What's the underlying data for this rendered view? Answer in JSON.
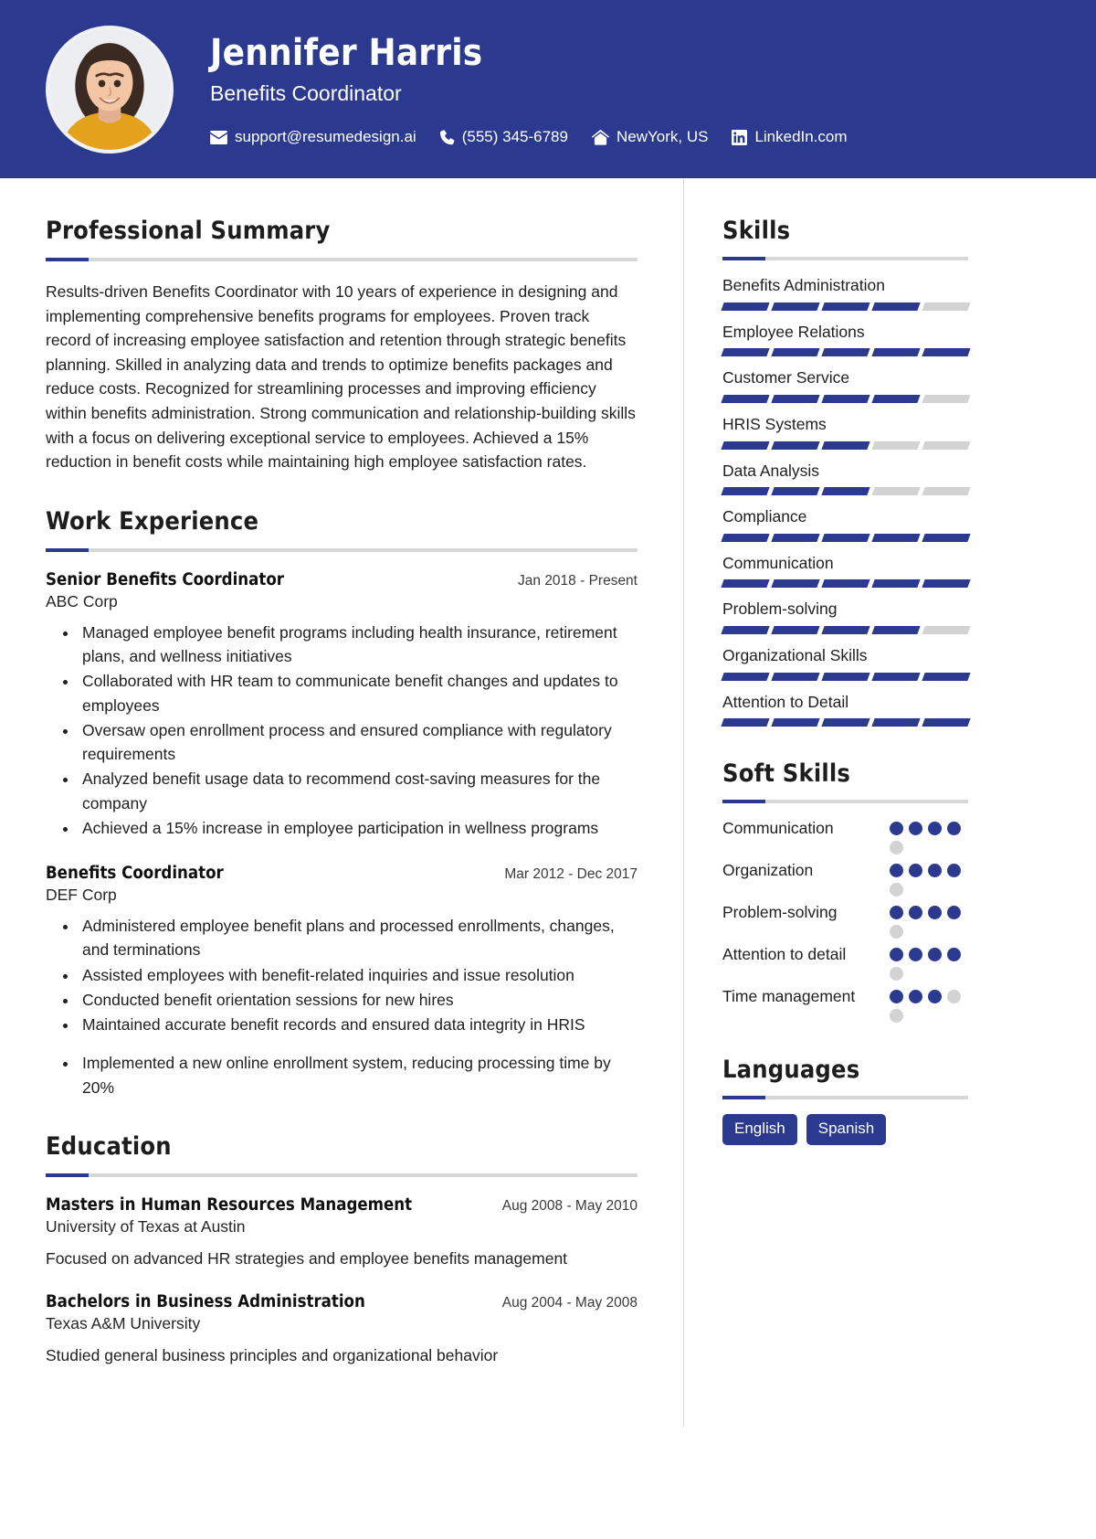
{
  "header": {
    "name": "Jennifer Harris",
    "job_title": "Benefits Coordinator",
    "accent_color": "#2b3a8f",
    "contacts": [
      {
        "icon": "envelope-icon",
        "text": "support@resumedesign.ai"
      },
      {
        "icon": "phone-icon",
        "text": "(555) 345-6789"
      },
      {
        "icon": "home-icon",
        "text": "NewYork, US"
      },
      {
        "icon": "linkedin-icon",
        "text": "LinkedIn.com"
      }
    ]
  },
  "summary": {
    "title": "Professional Summary",
    "text": "Results-driven Benefits Coordinator with 10 years of experience in designing and implementing comprehensive benefits programs for employees. Proven track record of increasing employee satisfaction and retention through strategic benefits planning. Skilled in analyzing data and trends to optimize benefits packages and reduce costs. Recognized for streamlining processes and improving efficiency within benefits administration. Strong communication and relationship-building skills with a focus on delivering exceptional service to employees. Achieved a 15% reduction in benefit costs while maintaining high employee satisfaction rates."
  },
  "experience": {
    "title": "Work Experience",
    "jobs": [
      {
        "role": "Senior Benefits Coordinator",
        "date": "Jan 2018 - Present",
        "company": "ABC Corp",
        "bullets": [
          "Managed employee benefit programs including health insurance, retirement plans, and wellness initiatives",
          "Collaborated with HR team to communicate benefit changes and updates to employees",
          "Oversaw open enrollment process and ensured compliance with regulatory requirements",
          "Analyzed benefit usage data to recommend cost-saving measures for the company",
          "Achieved a 15% increase in employee participation in wellness programs"
        ]
      },
      {
        "role": "Benefits Coordinator",
        "date": "Mar 2012 - Dec 2017",
        "company": "DEF Corp",
        "bullets": [
          "Administered employee benefit plans and processed enrollments, changes, and terminations",
          "Assisted employees with benefit-related inquiries and issue resolution",
          "Conducted benefit orientation sessions for new hires",
          "Maintained accurate benefit records and ensured data integrity in HRIS",
          "Implemented a new online enrollment system, reducing processing time by 20%"
        ]
      }
    ]
  },
  "education": {
    "title": "Education",
    "entries": [
      {
        "degree": "Masters in Human Resources Management",
        "date": "Aug 2008 - May 2010",
        "school": "University of Texas at Austin",
        "description": "Focused on advanced HR strategies and employee benefits management"
      },
      {
        "degree": "Bachelors in Business Administration",
        "date": "Aug 2004 - May 2008",
        "school": "Texas A&M University",
        "description": "Studied general business principles and organizational behavior"
      }
    ]
  },
  "skills": {
    "title": "Skills",
    "max_level": 5,
    "items": [
      {
        "name": "Benefits Administration",
        "level": 4
      },
      {
        "name": "Employee Relations",
        "level": 5
      },
      {
        "name": "Customer Service",
        "level": 4
      },
      {
        "name": "HRIS Systems",
        "level": 3
      },
      {
        "name": "Data Analysis",
        "level": 3
      },
      {
        "name": "Compliance",
        "level": 5
      },
      {
        "name": "Communication",
        "level": 5
      },
      {
        "name": "Problem-solving",
        "level": 4
      },
      {
        "name": "Organizational Skills",
        "level": 5
      },
      {
        "name": "Attention to Detail",
        "level": 5
      }
    ]
  },
  "soft_skills": {
    "title": "Soft Skills",
    "max_level": 5,
    "items": [
      {
        "name": "Communication",
        "level": 4
      },
      {
        "name": "Organization",
        "level": 4
      },
      {
        "name": "Problem-solving",
        "level": 4
      },
      {
        "name": "Attention to detail",
        "level": 4
      },
      {
        "name": "Time management",
        "level": 3
      }
    ]
  },
  "languages": {
    "title": "Languages",
    "items": [
      "English",
      "Spanish"
    ]
  }
}
